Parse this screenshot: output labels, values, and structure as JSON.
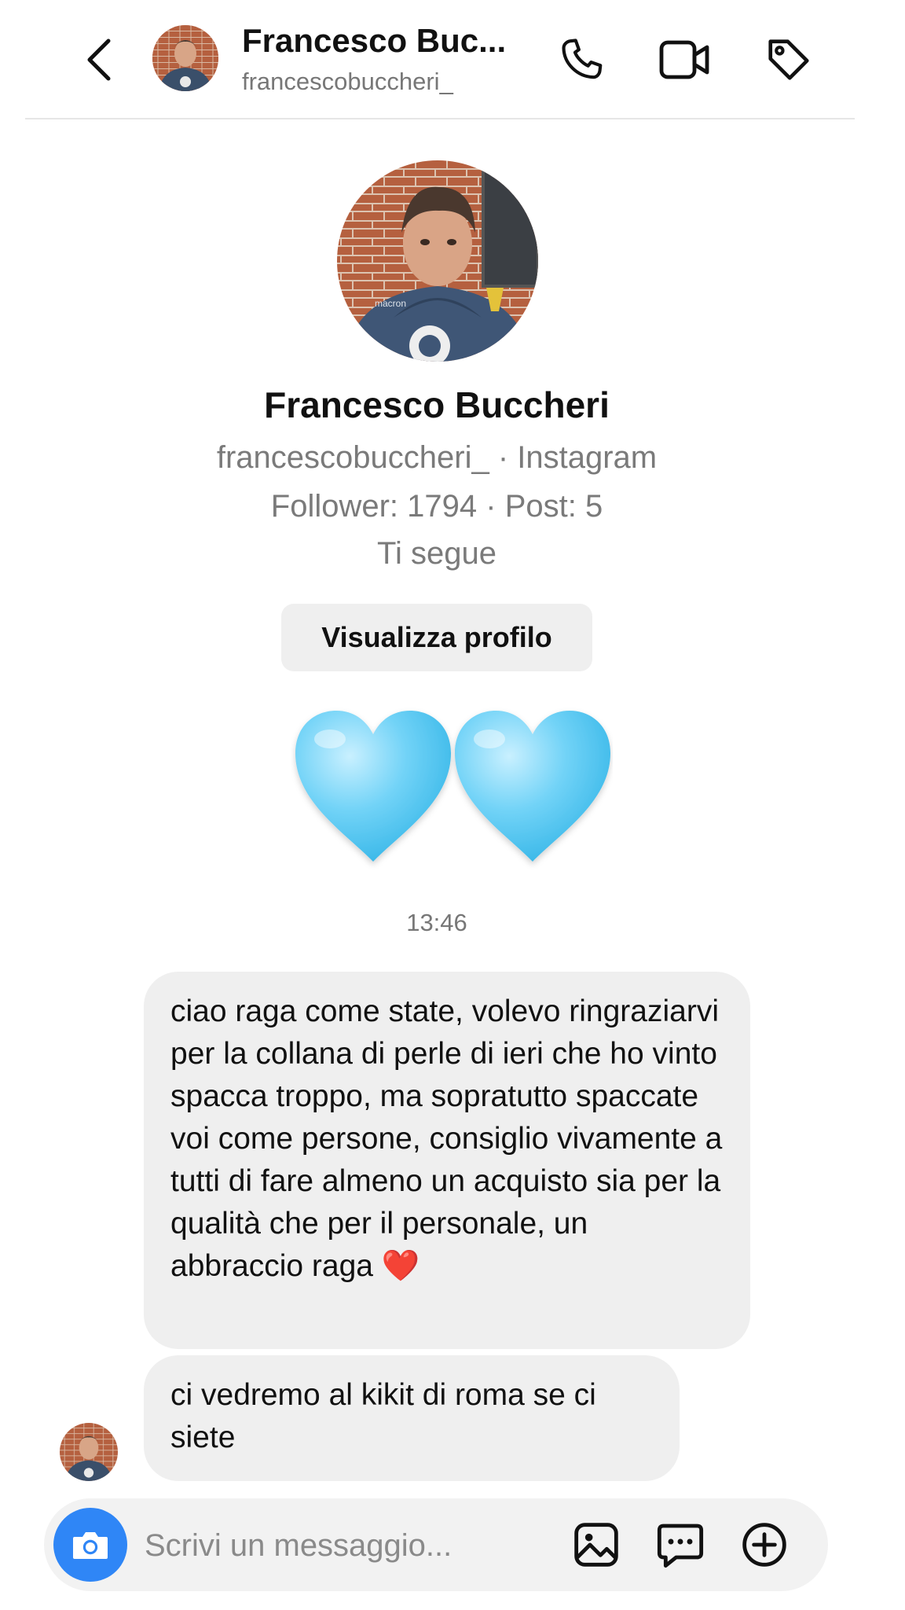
{
  "header": {
    "name": "Francesco Buc...",
    "username": "francescobuccheri_",
    "icons": [
      "back-icon",
      "phone-icon",
      "video-icon",
      "tag-icon"
    ]
  },
  "profile": {
    "name": "Francesco Buccheri",
    "handle_line": "francescobuccheri_ · Instagram",
    "stats_line": "Follower: 1794 · Post: 5",
    "follow_status": "Ti segue",
    "view_button": "Visualizza profilo"
  },
  "conversation": {
    "timestamp": "13:46",
    "messages": [
      {
        "text": "ciao raga come state, volevo ringraziarvi per la collana di perle di ieri che ho vinto spacca troppo, ma sopratutto spaccate voi come persone, consiglio vivamente a tutti di fare almeno un acquisto sia per la qualità che per il personale, un abbraccio raga ❤️"
      },
      {
        "text": "ci vedremo al kikit di roma se ci siete"
      }
    ]
  },
  "composer": {
    "placeholder": "Scrivi un messaggio...",
    "icons": [
      "camera-icon",
      "gallery-icon",
      "sticker-icon",
      "add-icon"
    ]
  },
  "colors": {
    "accent": "#2f86f6",
    "heart": "#5fc8f0",
    "bubble": "#efefef",
    "muted_text": "#7a7a7a"
  }
}
